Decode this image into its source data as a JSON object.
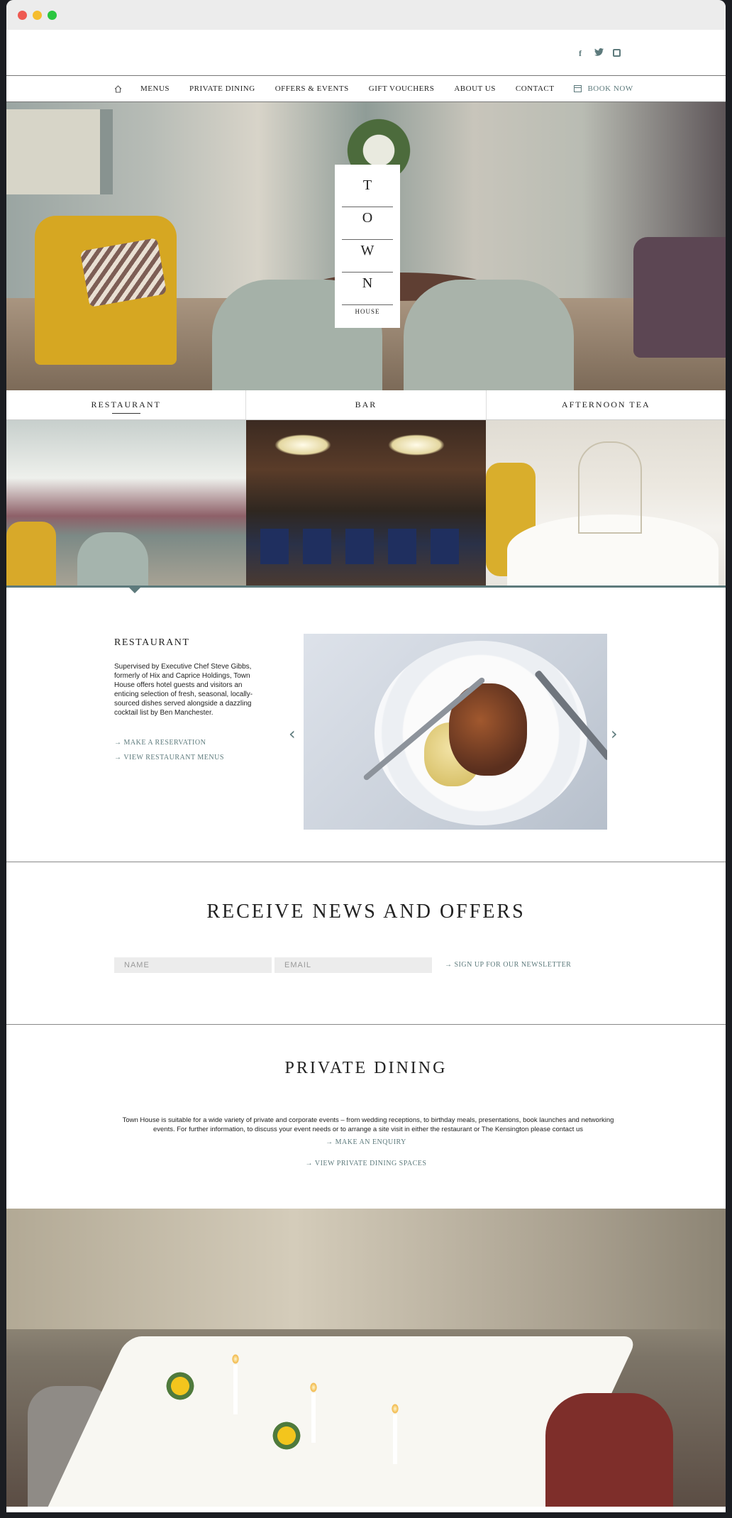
{
  "nav": {
    "items": [
      "MENUS",
      "PRIVATE DINING",
      "OFFERS & EVENTS",
      "GIFT VOUCHERS",
      "ABOUT US",
      "CONTACT"
    ],
    "book": "BOOK NOW"
  },
  "social": [
    "f",
    "twitter-icon",
    "instagram-icon"
  ],
  "logo": {
    "letters": [
      "T",
      "O",
      "W",
      "N"
    ],
    "sub": "HOUSE"
  },
  "tabs": [
    "RESTAURANT",
    "BAR",
    "AFTERNOON TEA"
  ],
  "feature": {
    "title": "RESTAURANT",
    "body": "Supervised by Executive Chef Steve Gibbs, formerly of Hix and Caprice Holdings, Town House offers hotel guests and visitors an enticing selection of fresh, seasonal, locally-sourced dishes served alongside a dazzling cocktail list by Ben Manchester.",
    "link1": "MAKE A RESERVATION",
    "link2": "VIEW RESTAURANT MENUS"
  },
  "news": {
    "title": "RECEIVE NEWS AND OFFERS",
    "name_placeholder": "NAME",
    "email_placeholder": "EMAIL",
    "signup": "SIGN UP FOR OUR NEWSLETTER"
  },
  "private_dining": {
    "title": "PRIVATE DINING",
    "body": "Town House is suitable for a wide variety of private and corporate events – from wedding receptions, to birthday meals, presentations, book launches and networking events. For further information, to discuss your event needs or to arrange a site visit in either the restaurant or The Kensington please contact us",
    "link1": "MAKE AN ENQUIRY",
    "link2": "VIEW PRIVATE DINING SPACES"
  },
  "colors": {
    "accent": "#5d7a7c"
  }
}
